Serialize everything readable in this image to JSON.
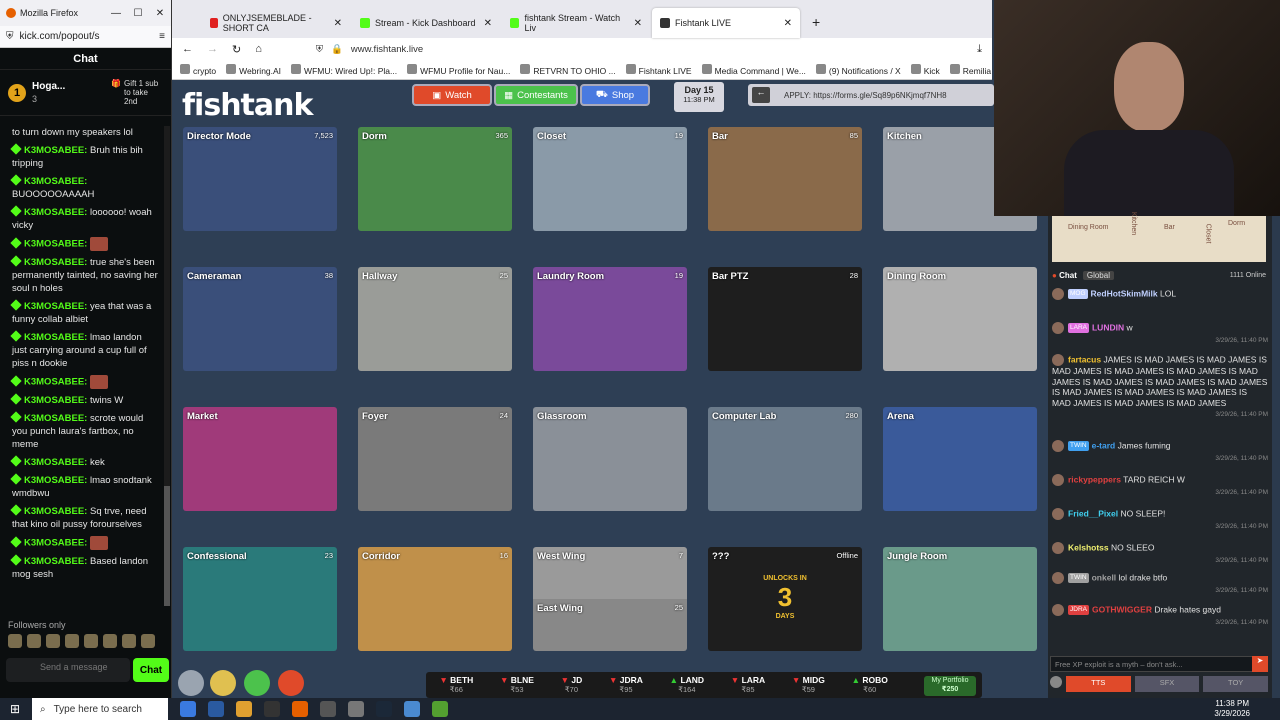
{
  "kick": {
    "window_title": "Mozilla Firefox",
    "url": "kick.com/popout/s",
    "chat_header": "Chat",
    "top_user": "Hoga...",
    "top_rank": "1",
    "top_count": "3",
    "gift_text": "Gift 1 sub to take 2nd",
    "messages": [
      {
        "name": "",
        "text": "to turn down my speakers lol"
      },
      {
        "name": "K3MOSABEE:",
        "text": "Bruh this bih tripping"
      },
      {
        "name": "K3MOSABEE:",
        "text": "BUOOOOOAAAAH"
      },
      {
        "name": "K3MOSABEE:",
        "text": "loooooo! woah vicky"
      },
      {
        "name": "K3MOSABEE:",
        "text": ""
      },
      {
        "name": "K3MOSABEE:",
        "text": "true she's been permanently tainted, no saving her soul n holes"
      },
      {
        "name": "K3MOSABEE:",
        "text": "yea that was a funny collab albiet"
      },
      {
        "name": "K3MOSABEE:",
        "text": "lmao landon just carrying around a cup full of piss n dookie"
      },
      {
        "name": "K3MOSABEE:",
        "text": ""
      },
      {
        "name": "K3MOSABEE:",
        "text": "twins W"
      },
      {
        "name": "K3MOSABEE:",
        "text": "scrote would you punch laura's fartbox, no meme"
      },
      {
        "name": "K3MOSABEE:",
        "text": "kek"
      },
      {
        "name": "K3MOSABEE:",
        "text": "lmao snodtank wmdbwu"
      },
      {
        "name": "K3MOSABEE:",
        "text": "Sq trve, need that kino oil pussy forourselves"
      },
      {
        "name": "K3MOSABEE:",
        "text": ""
      },
      {
        "name": "K3MOSABEE:",
        "text": "Based landon mog sesh"
      }
    ],
    "followers_only": "Followers only",
    "input_placeholder": "Send a message",
    "chat_button": "Chat"
  },
  "browser": {
    "tabs": [
      {
        "label": "ONLYJSEMEBLADE - SHORT CA",
        "color": "#e02020"
      },
      {
        "label": "Stream - Kick Dashboard",
        "color": "#53fc18"
      },
      {
        "label": "fishtank Stream - Watch Liv",
        "color": "#53fc18"
      },
      {
        "label": "Fishtank LIVE",
        "color": "#333333"
      }
    ],
    "address": "www.fishtank.live",
    "bookmarks": [
      "crypto",
      "Webring.AI",
      "WFMU: Wired Up!: Pla...",
      "WFMU Profile for Nau...",
      "RETVRN TO OHIO ...",
      "Fishtank LIVE",
      "Media Command | We...",
      "(9) Notifications / X",
      "Kick",
      "Remilia User Profiles"
    ]
  },
  "site": {
    "logo": "fishtank",
    "watch_btn": "Watch",
    "contestants_btn": "Contestants",
    "shop_btn": "Shop",
    "day_label": "Day 15",
    "day_time": "11:38 PM",
    "apply_text": "APPLY: https://forms.gle/Sq89p6NKjmqf7NH8",
    "cameras": [
      {
        "label": "Director Mode",
        "viewers": "7,523",
        "bg": "#3a4f7a"
      },
      {
        "label": "Dorm",
        "viewers": "365",
        "bg": "#4a8a4a"
      },
      {
        "label": "Closet",
        "viewers": "19",
        "bg": "#8a9aa8"
      },
      {
        "label": "Bar",
        "viewers": "85",
        "bg": "#8a6a4a"
      },
      {
        "label": "Kitchen",
        "viewers": "",
        "bg": "#9aa0a8"
      },
      {
        "label": "Cameraman",
        "viewers": "38",
        "bg": "#3a4f7a"
      },
      {
        "label": "Hallway",
        "viewers": "25",
        "bg": "#9a9c98"
      },
      {
        "label": "Laundry Room",
        "viewers": "19",
        "bg": "#7a4a9a"
      },
      {
        "label": "Bar PTZ",
        "viewers": "28",
        "bg": "#1e1e1e"
      },
      {
        "label": "Dining Room",
        "viewers": "",
        "bg": "#b0b0b0"
      },
      {
        "label": "Market",
        "viewers": "",
        "bg": "#a03a7a"
      },
      {
        "label": "Foyer",
        "viewers": "24",
        "bg": "#7a7a7a"
      },
      {
        "label": "Glassroom",
        "viewers": "",
        "bg": "#8a9098"
      },
      {
        "label": "Computer Lab",
        "viewers": "280",
        "bg": "#6a7a8a"
      },
      {
        "label": "Arena",
        "viewers": "",
        "bg": "#3a5a9a"
      },
      {
        "label": "Confessional",
        "viewers": "23",
        "bg": "#2a7a7a"
      },
      {
        "label": "Corridor",
        "viewers": "16",
        "bg": "#c0904a"
      },
      {
        "label": "West Wing",
        "viewers": "7",
        "bg": "#9a9a9a"
      },
      {
        "label": "???",
        "viewers": "Offline",
        "bg": "#1e1e1e"
      },
      {
        "label": "Jungle Room",
        "viewers": "",
        "bg": "#6a9a8a"
      }
    ],
    "east_wing_label": "East Wing",
    "east_wing_viewers": "25",
    "unlocks_text": "UNLOCKS IN",
    "unlocks_num": "3",
    "unlocks_days": "DAYS",
    "tickers": [
      {
        "name": "BETH",
        "value": "₹66",
        "dir": "down"
      },
      {
        "name": "BLNE",
        "value": "₹53",
        "dir": "down"
      },
      {
        "name": "JD",
        "value": "₹70",
        "dir": "down"
      },
      {
        "name": "JDRA",
        "value": "₹95",
        "dir": "down"
      },
      {
        "name": "LAND",
        "value": "₹164",
        "dir": "up"
      },
      {
        "name": "LARA",
        "value": "₹85",
        "dir": "down"
      },
      {
        "name": "MIDG",
        "value": "₹59",
        "dir": "down"
      },
      {
        "name": "ROBO",
        "value": "₹60",
        "dir": "up"
      }
    ],
    "portfolio_label": "My Portfolio",
    "portfolio_value": "₹250"
  },
  "right_chat": {
    "map_rooms": [
      "Dining Room",
      "Kitchen",
      "Bar",
      "Closet",
      "Dorm"
    ],
    "chat_tab": "Chat",
    "global_tab": "Global",
    "online": "1111 Online",
    "messages": [
      {
        "badge": "MOG",
        "name": "RedHotSkimMilk",
        "text": "LOL",
        "time": "",
        "color": "#c0d0ff"
      },
      {
        "badge": "LARA",
        "name": "LUNDIN",
        "text": "w",
        "time": "3/29/26, 11:40 PM",
        "color": "#e070e0"
      },
      {
        "badge": "",
        "name": "fartacus",
        "text": "JAMES IS MAD JAMES IS MAD JAMES IS MAD JAMES IS MAD JAMES IS MAD JAMES IS MAD JAMES IS MAD JAMES IS MAD JAMES IS MAD JAMES IS MAD JAMES IS MAD JAMES IS MAD JAMES IS MAD JAMES IS MAD JAMES IS MAD JAMES",
        "time": "3/29/26, 11:40 PM",
        "color": "#f0c030"
      },
      {
        "badge": "TWIN",
        "name": "e-tard",
        "text": "James fuming",
        "time": "3/29/26, 11:40 PM",
        "color": "#40a0f0"
      },
      {
        "badge": "",
        "name": "rickypeppers",
        "text": "TARD REICH W",
        "time": "3/29/26, 11:40 PM",
        "color": "#e04040"
      },
      {
        "badge": "",
        "name": "Fried__Pixel",
        "text": "NO SLEEP!",
        "time": "3/29/26, 11:40 PM",
        "color": "#40d0f0"
      },
      {
        "badge": "",
        "name": "Kelshotss",
        "text": "NO SLEEO",
        "time": "3/29/26, 11:40 PM",
        "color": "#f0f070"
      },
      {
        "badge": "TWIN",
        "name": "onkell",
        "text": "lol drake btfo",
        "time": "3/29/26, 11:40 PM",
        "color": "#a0a0a0"
      },
      {
        "badge": "JDRA",
        "name": "GOTHWIGGER",
        "text": "Drake hates gayd",
        "time": "3/29/26, 11:40 PM",
        "color": "#e04040"
      }
    ],
    "input_placeholder": "Free XP exploit is a myth – don't ask...",
    "tts_btn": "TTS",
    "sfx_btn": "SFX",
    "toy_btn": "TOY"
  },
  "taskbar": {
    "search": "Type here to search",
    "time": "11:38 PM",
    "date": "3/29/2026"
  }
}
